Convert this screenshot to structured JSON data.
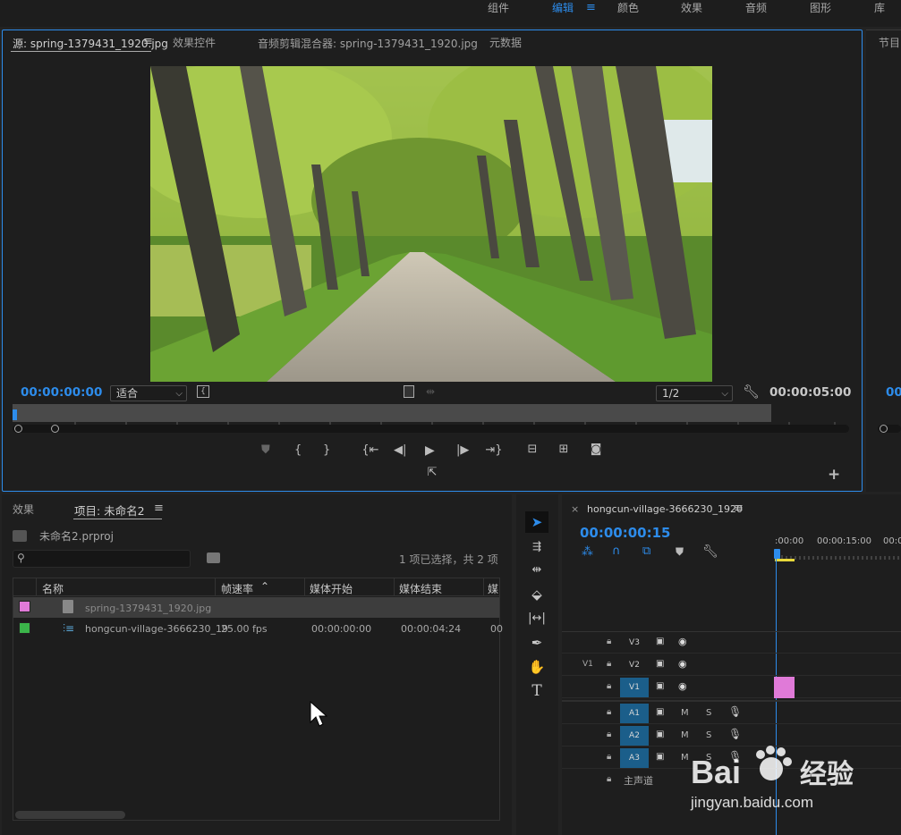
{
  "workspaces": {
    "items": [
      "组件",
      "编辑",
      "颜色",
      "效果",
      "音频",
      "图形",
      "库"
    ],
    "active": "编辑",
    "menu_icon": "hamburger-icon"
  },
  "source_panel": {
    "tabs": [
      "源: spring-1379431_1920.jpg",
      "效果控件",
      "音频剪辑混合器: spring-1379431_1920.jpg",
      "元数据"
    ],
    "active_tab_menu_icon": "hamburger-icon",
    "timecode_in": "00:00:00:00",
    "fit_select": "适合",
    "resolution_select": "1/2",
    "timecode_duration": "00:00:05:00",
    "image_description": "photo"
  },
  "program_panel": {
    "tab": "节目",
    "timecode": "00"
  },
  "project_panel": {
    "tabs": [
      "效果",
      "项目: 未命名2"
    ],
    "project_file": "未命名2.prproj",
    "selection_status": "1 项已选择，共 2 项",
    "columns": [
      "名称",
      "帧速率",
      "媒体开始",
      "媒体结束",
      "媒"
    ],
    "rows": [
      {
        "color": "#e07ad8",
        "name": "spring-1379431_1920.jpg",
        "fps": "",
        "start": "",
        "end": "",
        "selected": true
      },
      {
        "color": "#3bb54a",
        "name": "hongcun-village-3666230_19",
        "fps": "25.00 fps",
        "start": "00:00:00:00",
        "end": "00:00:04:24",
        "extra": "00",
        "selected": false
      }
    ]
  },
  "timeline": {
    "sequence_name": "hongcun-village-3666230_1920",
    "timecode": "00:00:00:15",
    "ruler_labels": [
      ":00:00",
      "00:00:15:00",
      "00:0"
    ],
    "video_tracks": [
      {
        "name": "V3",
        "source_patch": "",
        "targeted": false
      },
      {
        "name": "V2",
        "source_patch": "V1",
        "targeted": false
      },
      {
        "name": "V1",
        "source_patch": "",
        "targeted": true
      }
    ],
    "audio_tracks": [
      {
        "name": "A1",
        "m": "M",
        "s": "S"
      },
      {
        "name": "A2",
        "m": "M",
        "s": "S"
      },
      {
        "name": "A3",
        "m": "M",
        "s": "S"
      }
    ],
    "master_track": "主声道",
    "clip_color": "#e07ad8"
  },
  "watermark": {
    "logo": "Bai 经验",
    "url": "jingyan.baidu.com"
  }
}
